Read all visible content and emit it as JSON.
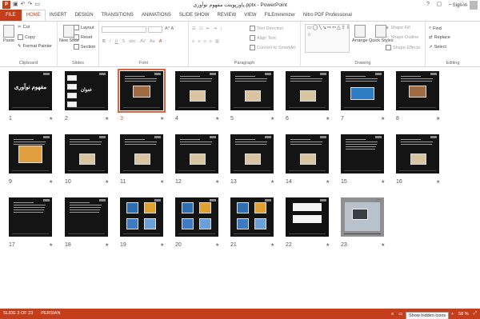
{
  "window": {
    "title": "پاورپوینت مفهوم نوآوری.pptx - PowerPoint",
    "signin": "Sign in",
    "qat": {
      "app_icon": "P"
    }
  },
  "tabs": [
    "FILE",
    "HOME",
    "INSERT",
    "DESIGN",
    "TRANSITIONS",
    "ANIMATIONS",
    "SLIDE SHOW",
    "REVIEW",
    "VIEW",
    "FILEminimizer",
    "Nitro PDF Professional"
  ],
  "ribbon": {
    "clipboard": {
      "label": "Clipboard",
      "paste": "Paste",
      "cut": "Cut",
      "copy": "Copy",
      "format_painter": "Format Painter"
    },
    "slides": {
      "label": "Slides",
      "new_slide": "New Slide",
      "layout": "Layout",
      "reset": "Reset",
      "section": "Section"
    },
    "font": {
      "label": "Font",
      "bold": "B",
      "italic": "I",
      "underline": "U",
      "shadow": "S",
      "strike": "abc",
      "spacing": "AV",
      "case": "Aa"
    },
    "paragraph": {
      "label": "Paragraph",
      "text_direction": "Text Direction",
      "align_text": "Align Text",
      "convert_smartart": "Convert to SmartArt"
    },
    "drawing": {
      "label": "Drawing",
      "arrange": "Arrange",
      "quick_styles": "Quick Styles",
      "shape_fill": "Shape Fill",
      "shape_outline": "Shape Outline",
      "shape_effects": "Shape Effects",
      "shapes_glyphs": "▭◯╲↘⇨⇦△⇧⇩⌒{}☆"
    },
    "editing": {
      "label": "Editing",
      "find": "Find",
      "replace": "Replace",
      "select": "Select"
    }
  },
  "slides": [
    {
      "n": "1",
      "t": "title",
      "cap": "مفهوم نوآوری"
    },
    {
      "n": "2",
      "t": "title2",
      "cap": "عنوان"
    },
    {
      "n": "3",
      "t": "pic",
      "sel": true
    },
    {
      "n": "4",
      "t": "textpic"
    },
    {
      "n": "5",
      "t": "textpic"
    },
    {
      "n": "6",
      "t": "textpic"
    },
    {
      "n": "7",
      "t": "blue"
    },
    {
      "n": "8",
      "t": "pic"
    },
    {
      "n": "9",
      "t": "sunset"
    },
    {
      "n": "10",
      "t": "textpic"
    },
    {
      "n": "11",
      "t": "textpic"
    },
    {
      "n": "12",
      "t": "textpic"
    },
    {
      "n": "13",
      "t": "textpic"
    },
    {
      "n": "14",
      "t": "textpic"
    },
    {
      "n": "15",
      "t": "text"
    },
    {
      "n": "16",
      "t": "textpic"
    },
    {
      "n": "17",
      "t": "text"
    },
    {
      "n": "18",
      "t": "text"
    },
    {
      "n": "19",
      "t": "grid"
    },
    {
      "n": "20",
      "t": "grid"
    },
    {
      "n": "21",
      "t": "grid"
    },
    {
      "n": "22",
      "t": "shapes"
    },
    {
      "n": "23",
      "t": "photo"
    }
  ],
  "star_glyph": "★",
  "status": {
    "slide_of": "SLIDE 3 OF 23",
    "language": "PERSIAN",
    "zoom": "58 %",
    "zoom_percent": 58,
    "tooltip": "Show hidden icons"
  },
  "colors": {
    "accent": "#c43e1c",
    "selection": "#e3603d",
    "slide_bg": "#141414"
  }
}
